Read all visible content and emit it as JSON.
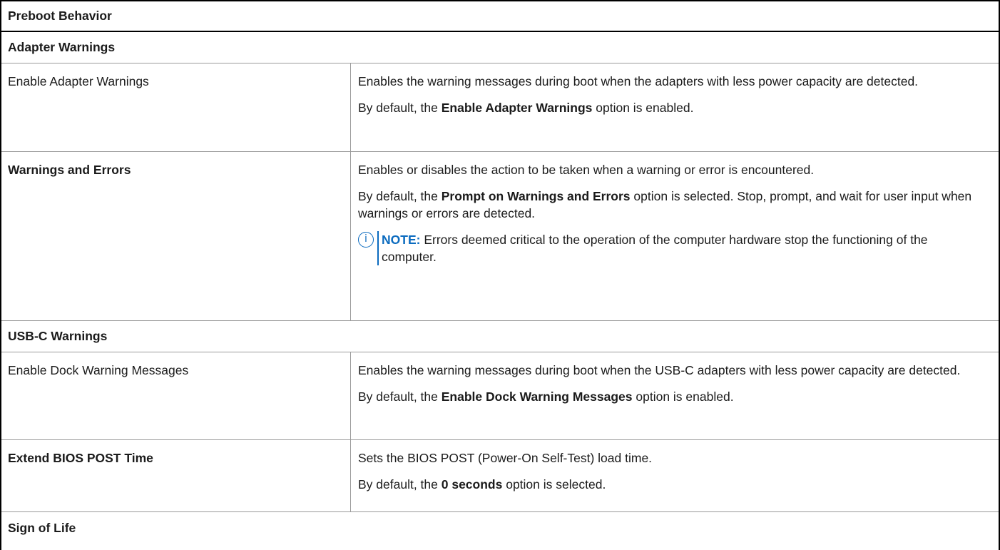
{
  "table": {
    "header": "Preboot Behavior",
    "section_adapter": "Adapter Warnings",
    "row_adapter": {
      "label": "Enable Adapter Warnings",
      "desc": "Enables the warning messages during boot when the adapters with less power capacity are detected.",
      "default_prefix": "By default, the ",
      "default_bold": "Enable Adapter Warnings",
      "default_suffix": " option is enabled."
    },
    "row_warnings": {
      "label": "Warnings and Errors",
      "desc": "Enables or disables the action to be taken when a warning or error is encountered.",
      "default_prefix": "By default, the ",
      "default_bold": "Prompt on Warnings and Errors",
      "default_suffix": " option is selected. Stop, prompt, and wait for user input when warnings or errors are detected.",
      "note_icon": "i",
      "note_label": "NOTE:",
      "note_text": " Errors deemed critical to the operation of the computer hardware stop the functioning of the computer."
    },
    "section_usbc": "USB-C Warnings",
    "row_dock": {
      "label": "Enable Dock Warning Messages",
      "desc": "Enables the warning messages during boot when the USB-C adapters with less power capacity are detected.",
      "default_prefix": "By default, the ",
      "default_bold": "Enable Dock Warning Messages",
      "default_suffix": " option is enabled."
    },
    "row_post": {
      "label": "Extend BIOS POST Time",
      "desc": "Sets the BIOS POST (Power-On Self-Test) load time.",
      "default_prefix": "By default, the ",
      "default_bold": "0 seconds",
      "default_suffix": " option is selected."
    },
    "section_sign": "Sign of Life"
  },
  "colors": {
    "border": "#000000",
    "rule": "#9a9a9a",
    "note_accent": "#0b6bbf",
    "text": "#1b1b1b"
  }
}
